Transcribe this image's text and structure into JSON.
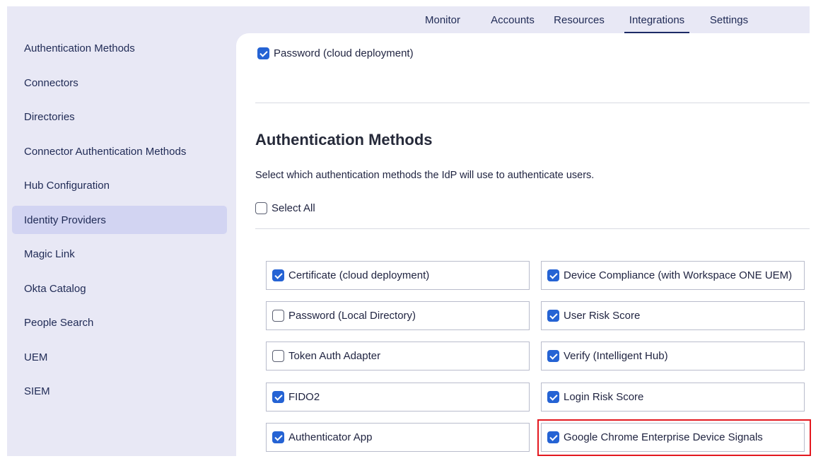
{
  "topnav": {
    "tabs": [
      {
        "label": "Monitor"
      },
      {
        "label": "Accounts"
      },
      {
        "label": "Resources"
      },
      {
        "label": "Integrations",
        "active": true
      },
      {
        "label": "Settings"
      }
    ]
  },
  "sidebar": {
    "items": [
      {
        "label": "Authentication Methods"
      },
      {
        "label": "Connectors"
      },
      {
        "label": "Directories"
      },
      {
        "label": "Connector Authentication Methods"
      },
      {
        "label": "Hub Configuration"
      },
      {
        "label": "Identity Providers",
        "active": true
      },
      {
        "label": "Magic Link"
      },
      {
        "label": "Okta Catalog"
      },
      {
        "label": "People Search"
      },
      {
        "label": "UEM"
      },
      {
        "label": "SIEM"
      }
    ]
  },
  "main": {
    "top_option": {
      "label": "Password (cloud deployment)",
      "checked": true
    },
    "section_title": "Authentication Methods",
    "section_description": "Select which authentication methods the IdP will use to authenticate users.",
    "select_all": {
      "label": "Select All",
      "checked": false
    },
    "methods_left": [
      {
        "label": "Certificate (cloud deployment)",
        "checked": true
      },
      {
        "label": "Password (Local Directory)",
        "checked": false
      },
      {
        "label": "Token Auth Adapter",
        "checked": false
      },
      {
        "label": "FIDO2",
        "checked": true
      },
      {
        "label": "Authenticator App",
        "checked": true
      }
    ],
    "methods_right": [
      {
        "label": "Device Compliance (with Workspace ONE UEM)",
        "checked": true
      },
      {
        "label": "User Risk Score",
        "checked": true
      },
      {
        "label": "Verify (Intelligent Hub)",
        "checked": true
      },
      {
        "label": "Login Risk Score",
        "checked": true
      },
      {
        "label": "Google Chrome Enterprise Device Signals",
        "checked": true,
        "highlighted": true
      }
    ]
  },
  "colors": {
    "accent": "#2563d4",
    "nav_underline": "#1c2a66",
    "sidebar_bg": "#e8e8f5",
    "active_item_bg": "#d2d4f2",
    "highlight_border": "#e3181f"
  }
}
